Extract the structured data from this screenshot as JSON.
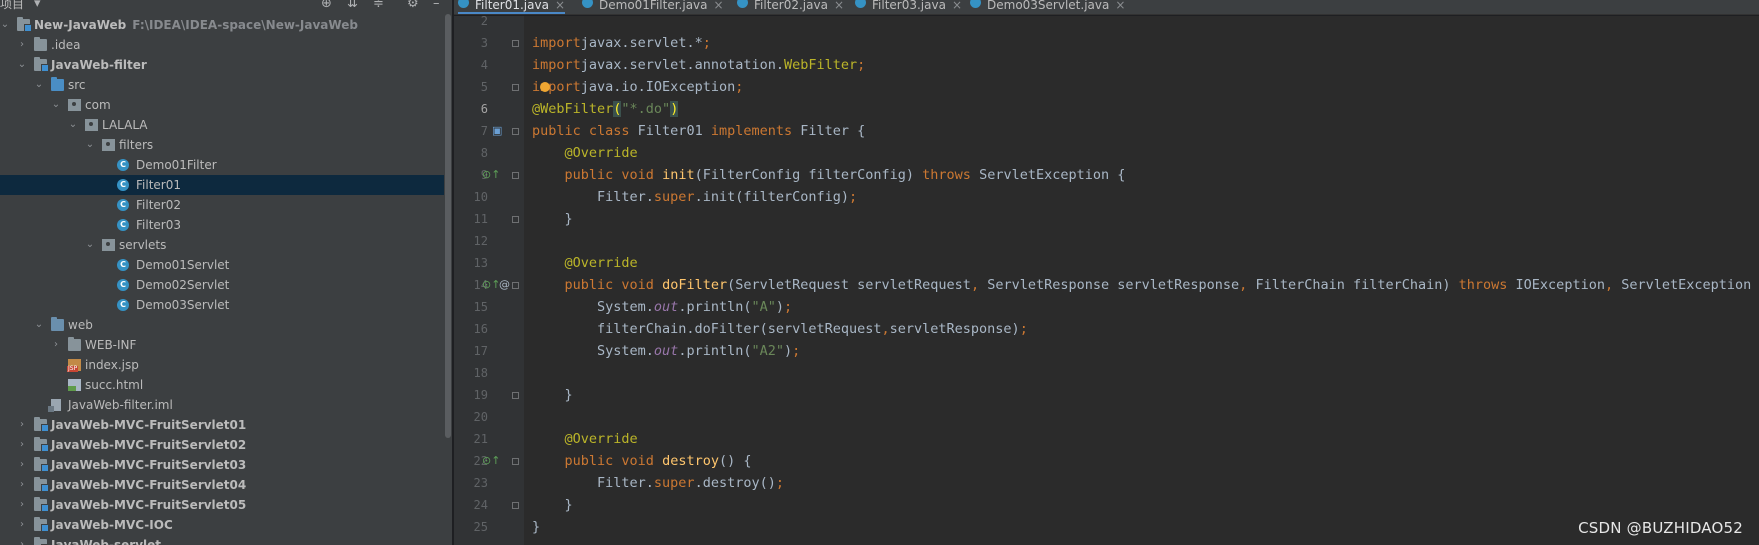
{
  "project_panel": {
    "title": "项目"
  },
  "tree": [
    {
      "label": "New-JavaWeb",
      "path": "F:\\IDEA\\IDEA-space\\New-JavaWeb",
      "bold": true,
      "icon": "module-folder-icon",
      "arrow": "down",
      "level": 0
    },
    {
      "label": ".idea",
      "bold": false,
      "icon": "folder-icon",
      "arrow": "right",
      "level": 1
    },
    {
      "label": "JavaWeb-filter",
      "bold": true,
      "icon": "module-folder-icon",
      "arrow": "down",
      "level": 1
    },
    {
      "label": "src",
      "bold": false,
      "icon": "source-folder-icon",
      "arrow": "down",
      "level": 2
    },
    {
      "label": "com",
      "bold": false,
      "icon": "package-icon",
      "arrow": "down",
      "level": 3
    },
    {
      "label": "LALALA",
      "bold": false,
      "icon": "package-icon",
      "arrow": "down",
      "level": 4
    },
    {
      "label": "filters",
      "bold": false,
      "icon": "package-icon",
      "arrow": "down",
      "level": 5
    },
    {
      "label": "Demo01Filter",
      "bold": false,
      "icon": "java-class-icon",
      "arrow": "",
      "level": 6
    },
    {
      "label": "Filter01",
      "bold": false,
      "icon": "java-class-icon",
      "arrow": "",
      "level": 6,
      "selected": true
    },
    {
      "label": "Filter02",
      "bold": false,
      "icon": "java-class-icon",
      "arrow": "",
      "level": 6
    },
    {
      "label": "Filter03",
      "bold": false,
      "icon": "java-class-icon",
      "arrow": "",
      "level": 6
    },
    {
      "label": "servlets",
      "bold": false,
      "icon": "package-icon",
      "arrow": "down",
      "level": 5
    },
    {
      "label": "Demo01Servlet",
      "bold": false,
      "icon": "java-class-icon",
      "arrow": "",
      "level": 6
    },
    {
      "label": "Demo02Servlet",
      "bold": false,
      "icon": "java-class-icon",
      "arrow": "",
      "level": 6
    },
    {
      "label": "Demo03Servlet",
      "bold": false,
      "icon": "java-class-icon",
      "arrow": "",
      "level": 6
    },
    {
      "label": "web",
      "bold": false,
      "icon": "web-folder-icon",
      "arrow": "down",
      "level": 2
    },
    {
      "label": "WEB-INF",
      "bold": false,
      "icon": "folder-icon",
      "arrow": "right",
      "level": 3
    },
    {
      "label": "index.jsp",
      "bold": false,
      "icon": "jsp-file-icon",
      "arrow": "",
      "level": 3
    },
    {
      "label": "succ.html",
      "bold": false,
      "icon": "html-file-icon",
      "arrow": "",
      "level": 3
    },
    {
      "label": "JavaWeb-filter.iml",
      "bold": false,
      "icon": "iml-file-icon",
      "arrow": "",
      "level": 2
    },
    {
      "label": "JavaWeb-MVC-FruitServlet01",
      "bold": true,
      "icon": "module-folder-icon",
      "arrow": "right",
      "level": 1
    },
    {
      "label": "JavaWeb-MVC-FruitServlet02",
      "bold": true,
      "icon": "module-folder-icon",
      "arrow": "right",
      "level": 1
    },
    {
      "label": "JavaWeb-MVC-FruitServlet03",
      "bold": true,
      "icon": "module-folder-icon",
      "arrow": "right",
      "level": 1
    },
    {
      "label": "JavaWeb-MVC-FruitServlet04",
      "bold": true,
      "icon": "module-folder-icon",
      "arrow": "right",
      "level": 1
    },
    {
      "label": "JavaWeb-MVC-FruitServlet05",
      "bold": true,
      "icon": "module-folder-icon",
      "arrow": "right",
      "level": 1
    },
    {
      "label": "JavaWeb-MVC-IOC",
      "bold": true,
      "icon": "module-folder-icon",
      "arrow": "right",
      "level": 1
    },
    {
      "label": "JavaWeb-servlet",
      "bold": true,
      "icon": "module-folder-icon",
      "arrow": "right",
      "level": 1
    }
  ],
  "tabs": [
    {
      "label": "Filter01.java",
      "active": true
    },
    {
      "label": "Demo01Filter.java",
      "active": false
    },
    {
      "label": "Filter02.java",
      "active": false
    },
    {
      "label": "Filter03.java",
      "active": false
    },
    {
      "label": "Demo03Servlet.java",
      "active": false
    }
  ],
  "editor": {
    "current_line": 6,
    "lines": [
      {
        "n": 2,
        "tokens": []
      },
      {
        "n": 3,
        "tokens": [
          [
            "kw",
            "import"
          ],
          [
            "",
            "javax.servlet.*"
          ],
          [
            "kw",
            ";"
          ]
        ]
      },
      {
        "n": 4,
        "tokens": [
          [
            "kw",
            "import"
          ],
          [
            "",
            "javax.servlet.annotation."
          ],
          [
            "an",
            "WebFilter"
          ],
          [
            "kw",
            ";"
          ]
        ]
      },
      {
        "n": 5,
        "tokens": [
          [
            "kw",
            "import"
          ],
          [
            "",
            "java.io.IOException"
          ],
          [
            "kw",
            ";"
          ]
        ]
      },
      {
        "n": 6,
        "tokens": [
          [
            "an",
            "@WebFilter"
          ],
          [
            "hl",
            "("
          ],
          [
            "st",
            "\"*.do\""
          ],
          [
            "hl",
            ")"
          ]
        ]
      },
      {
        "n": 7,
        "tokens": [
          [
            "kw",
            "public class "
          ],
          [
            "",
            "Filter01 "
          ],
          [
            "kw",
            "implements "
          ],
          [
            "",
            "Filter {"
          ]
        ]
      },
      {
        "n": 8,
        "tokens": [
          [
            "",
            "    "
          ],
          [
            "an",
            "@Override"
          ]
        ]
      },
      {
        "n": 9,
        "tokens": [
          [
            "",
            "    "
          ],
          [
            "kw",
            "public void "
          ],
          [
            "fn",
            "init"
          ],
          [
            "",
            "(FilterConfig filterConfig) "
          ],
          [
            "kw",
            "throws "
          ],
          [
            "",
            "ServletException {"
          ]
        ]
      },
      {
        "n": 10,
        "tokens": [
          [
            "",
            "        Filter."
          ],
          [
            "kw",
            "super"
          ],
          [
            "",
            ".init(filterConfig)"
          ],
          [
            "kw",
            ";"
          ]
        ]
      },
      {
        "n": 11,
        "tokens": [
          [
            "",
            "    }"
          ]
        ]
      },
      {
        "n": 12,
        "tokens": []
      },
      {
        "n": 13,
        "tokens": [
          [
            "",
            "    "
          ],
          [
            "an",
            "@Override"
          ]
        ]
      },
      {
        "n": 14,
        "tokens": [
          [
            "",
            "    "
          ],
          [
            "kw",
            "public void "
          ],
          [
            "fn",
            "doFilter"
          ],
          [
            "",
            "(ServletRequest servletRequest"
          ],
          [
            "kw",
            ", "
          ],
          [
            "",
            "ServletResponse servletResponse"
          ],
          [
            "kw",
            ", "
          ],
          [
            "",
            "FilterChain filterChain) "
          ],
          [
            "kw",
            "throws "
          ],
          [
            "",
            "IOException"
          ],
          [
            "kw",
            ", "
          ],
          [
            "",
            "ServletException {"
          ]
        ]
      },
      {
        "n": 15,
        "tokens": [
          [
            "",
            "        System."
          ],
          [
            "it",
            "out"
          ],
          [
            "",
            ".println("
          ],
          [
            "st",
            "\"A\""
          ],
          [
            "",
            ")"
          ],
          [
            "kw",
            ";"
          ]
        ]
      },
      {
        "n": 16,
        "tokens": [
          [
            "",
            "        filterChain.doFilter(servletRequest"
          ],
          [
            "kw",
            ","
          ],
          [
            "",
            "servletResponse)"
          ],
          [
            "kw",
            ";"
          ]
        ]
      },
      {
        "n": 17,
        "tokens": [
          [
            "",
            "        System."
          ],
          [
            "it",
            "out"
          ],
          [
            "",
            ".println("
          ],
          [
            "st",
            "\"A2\""
          ],
          [
            "",
            ")"
          ],
          [
            "kw",
            ";"
          ]
        ]
      },
      {
        "n": 18,
        "tokens": []
      },
      {
        "n": 19,
        "tokens": [
          [
            "",
            "    }"
          ]
        ]
      },
      {
        "n": 20,
        "tokens": []
      },
      {
        "n": 21,
        "tokens": [
          [
            "",
            "    "
          ],
          [
            "an",
            "@Override"
          ]
        ]
      },
      {
        "n": 22,
        "tokens": [
          [
            "",
            "    "
          ],
          [
            "kw",
            "public void "
          ],
          [
            "fn",
            "destroy"
          ],
          [
            "",
            "() {"
          ]
        ]
      },
      {
        "n": 23,
        "tokens": [
          [
            "",
            "        Filter."
          ],
          [
            "kw",
            "super"
          ],
          [
            "",
            ".destroy()"
          ],
          [
            "kw",
            ";"
          ]
        ]
      },
      {
        "n": 24,
        "tokens": [
          [
            "",
            "    }"
          ]
        ]
      },
      {
        "n": 25,
        "tokens": [
          [
            "",
            "}"
          ]
        ]
      }
    ]
  },
  "watermark": "CSDN @BUZHIDAO52",
  "colors": {
    "keyword": "#cc7832",
    "annotation": "#bbb529",
    "string": "#6a8759",
    "method": "#ffc66d",
    "static_field": "#9876aa",
    "selection": "#0d293e",
    "tab_underline": "#4a88c7"
  }
}
